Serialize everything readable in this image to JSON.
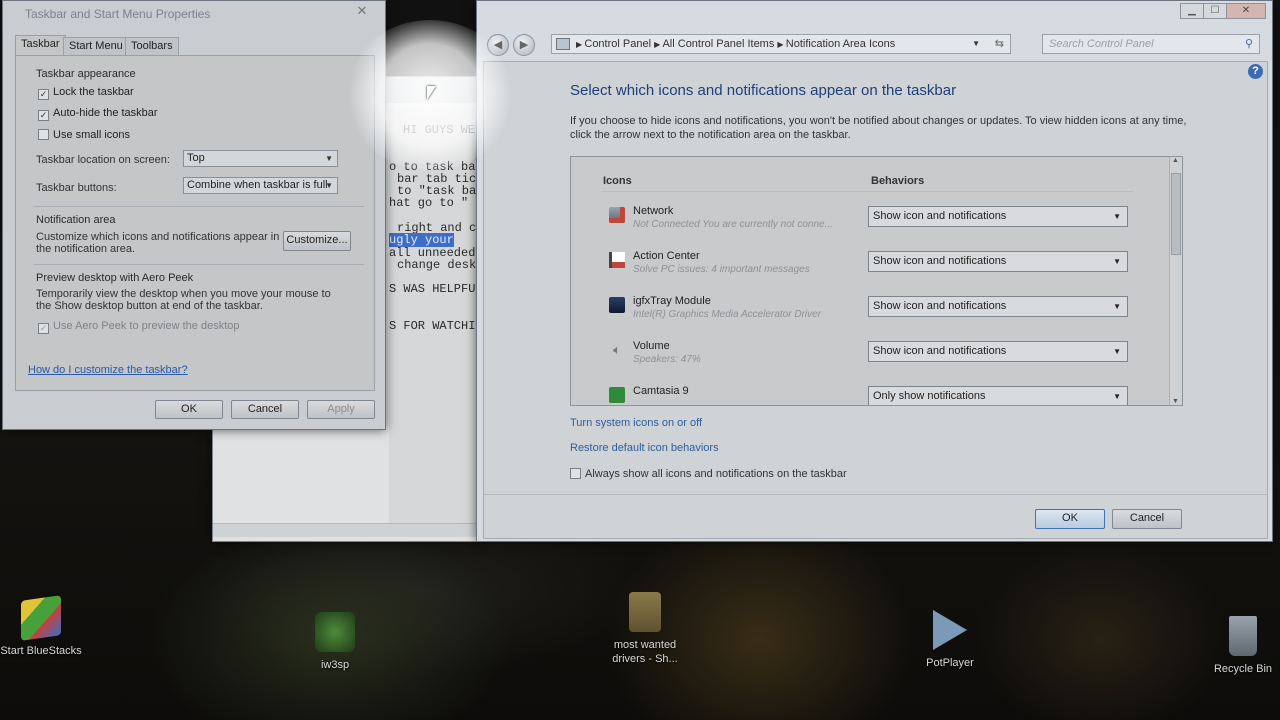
{
  "desktop": {
    "icons": [
      {
        "label": "Start BlueStacks",
        "icon": "bluestacks-icon"
      },
      {
        "label": "iw3sp",
        "icon": "iw3sp-icon"
      },
      {
        "label": "most wanted drivers - Sh...",
        "icon": "folder-shortcut-icon"
      },
      {
        "label": "PotPlayer",
        "icon": "potplayer-icon"
      },
      {
        "label": "Recycle Bin",
        "icon": "recycle-bin-icon"
      }
    ]
  },
  "taskbar_dialog": {
    "title": "Taskbar and Start Menu Properties",
    "tabs": [
      "Taskbar",
      "Start Menu",
      "Toolbars"
    ],
    "appearance_group": "Taskbar appearance",
    "lock_taskbar": {
      "label": "Lock the taskbar",
      "checked": true
    },
    "auto_hide": {
      "label": "Auto-hide the taskbar",
      "checked": true
    },
    "small_icons": {
      "label": "Use small icons",
      "checked": false
    },
    "location_label": "Taskbar location on screen:",
    "location_value": "Top",
    "buttons_label": "Taskbar buttons:",
    "buttons_value": "Combine when taskbar is full",
    "notification_group": "Notification area",
    "notification_desc": "Customize which icons and notifications appear in the notification area.",
    "customize_button": "Customize...",
    "aero_group": "Preview desktop with Aero Peek",
    "aero_desc": "Temporarily view the desktop when you move your mouse to the Show desktop button at end of the taskbar.",
    "aero_peek": {
      "label": "Use Aero Peek to preview the desktop",
      "checked": true
    },
    "help_link": "How do I customize the taskbar?",
    "ok": "OK",
    "cancel": "Cancel",
    "apply": "Apply"
  },
  "notepad": {
    "lines": [
      {
        "text": "HI GUYS WE"
      },
      {
        "text": "o to task ba"
      },
      {
        "text": "bar tab tic"
      },
      {
        "text": "to \"task ba"
      },
      {
        "text": "hat go to \""
      },
      {
        "text": "right and c"
      },
      {
        "text": " ugly your",
        "highlight": true
      },
      {
        "text": "all unneeded"
      },
      {
        "text": "change desk"
      },
      {
        "text": "S WAS HELPFU"
      },
      {
        "text": "S FOR WATCHI"
      }
    ]
  },
  "notif_window": {
    "breadcrumb": [
      "Control Panel",
      "All Control Panel Items",
      "Notification Area Icons"
    ],
    "search_placeholder": "Search Control Panel",
    "heading": "Select which icons and notifications appear on the taskbar",
    "description": "If you choose to hide icons and notifications, you won't be notified about changes or updates. To view hidden icons at any time, click the arrow next to the notification area on the taskbar.",
    "col_icons": "Icons",
    "col_behaviors": "Behaviors",
    "rows": [
      {
        "name": "Network",
        "sub": "Not Connected You are currently not conne...",
        "behavior": "Show icon and notifications",
        "icon": "network-icon"
      },
      {
        "name": "Action Center",
        "sub": "Solve PC issues: 4 important messages",
        "behavior": "Show icon and notifications",
        "icon": "action-center-flag-icon"
      },
      {
        "name": "igfxTray Module",
        "sub": "Intel(R) Graphics Media Accelerator Driver",
        "behavior": "Show icon and notifications",
        "icon": "intel-graphics-icon"
      },
      {
        "name": "Volume",
        "sub": "Speakers: 47%",
        "behavior": "Show icon and notifications",
        "icon": "speaker-icon"
      },
      {
        "name": "Camtasia 9",
        "sub": "",
        "behavior": "Only show notifications",
        "icon": "camtasia-icon"
      }
    ],
    "link_system_icons": "Turn system icons on or off",
    "link_restore": "Restore default icon behaviors",
    "always_show": {
      "label": "Always show all icons and notifications on the taskbar",
      "checked": false
    },
    "ok": "OK",
    "cancel": "Cancel"
  },
  "colors": {
    "heading_blue": "#1e3f7a",
    "link_blue": "#2d5c9e",
    "selection_blue": "#3d6ec8"
  }
}
